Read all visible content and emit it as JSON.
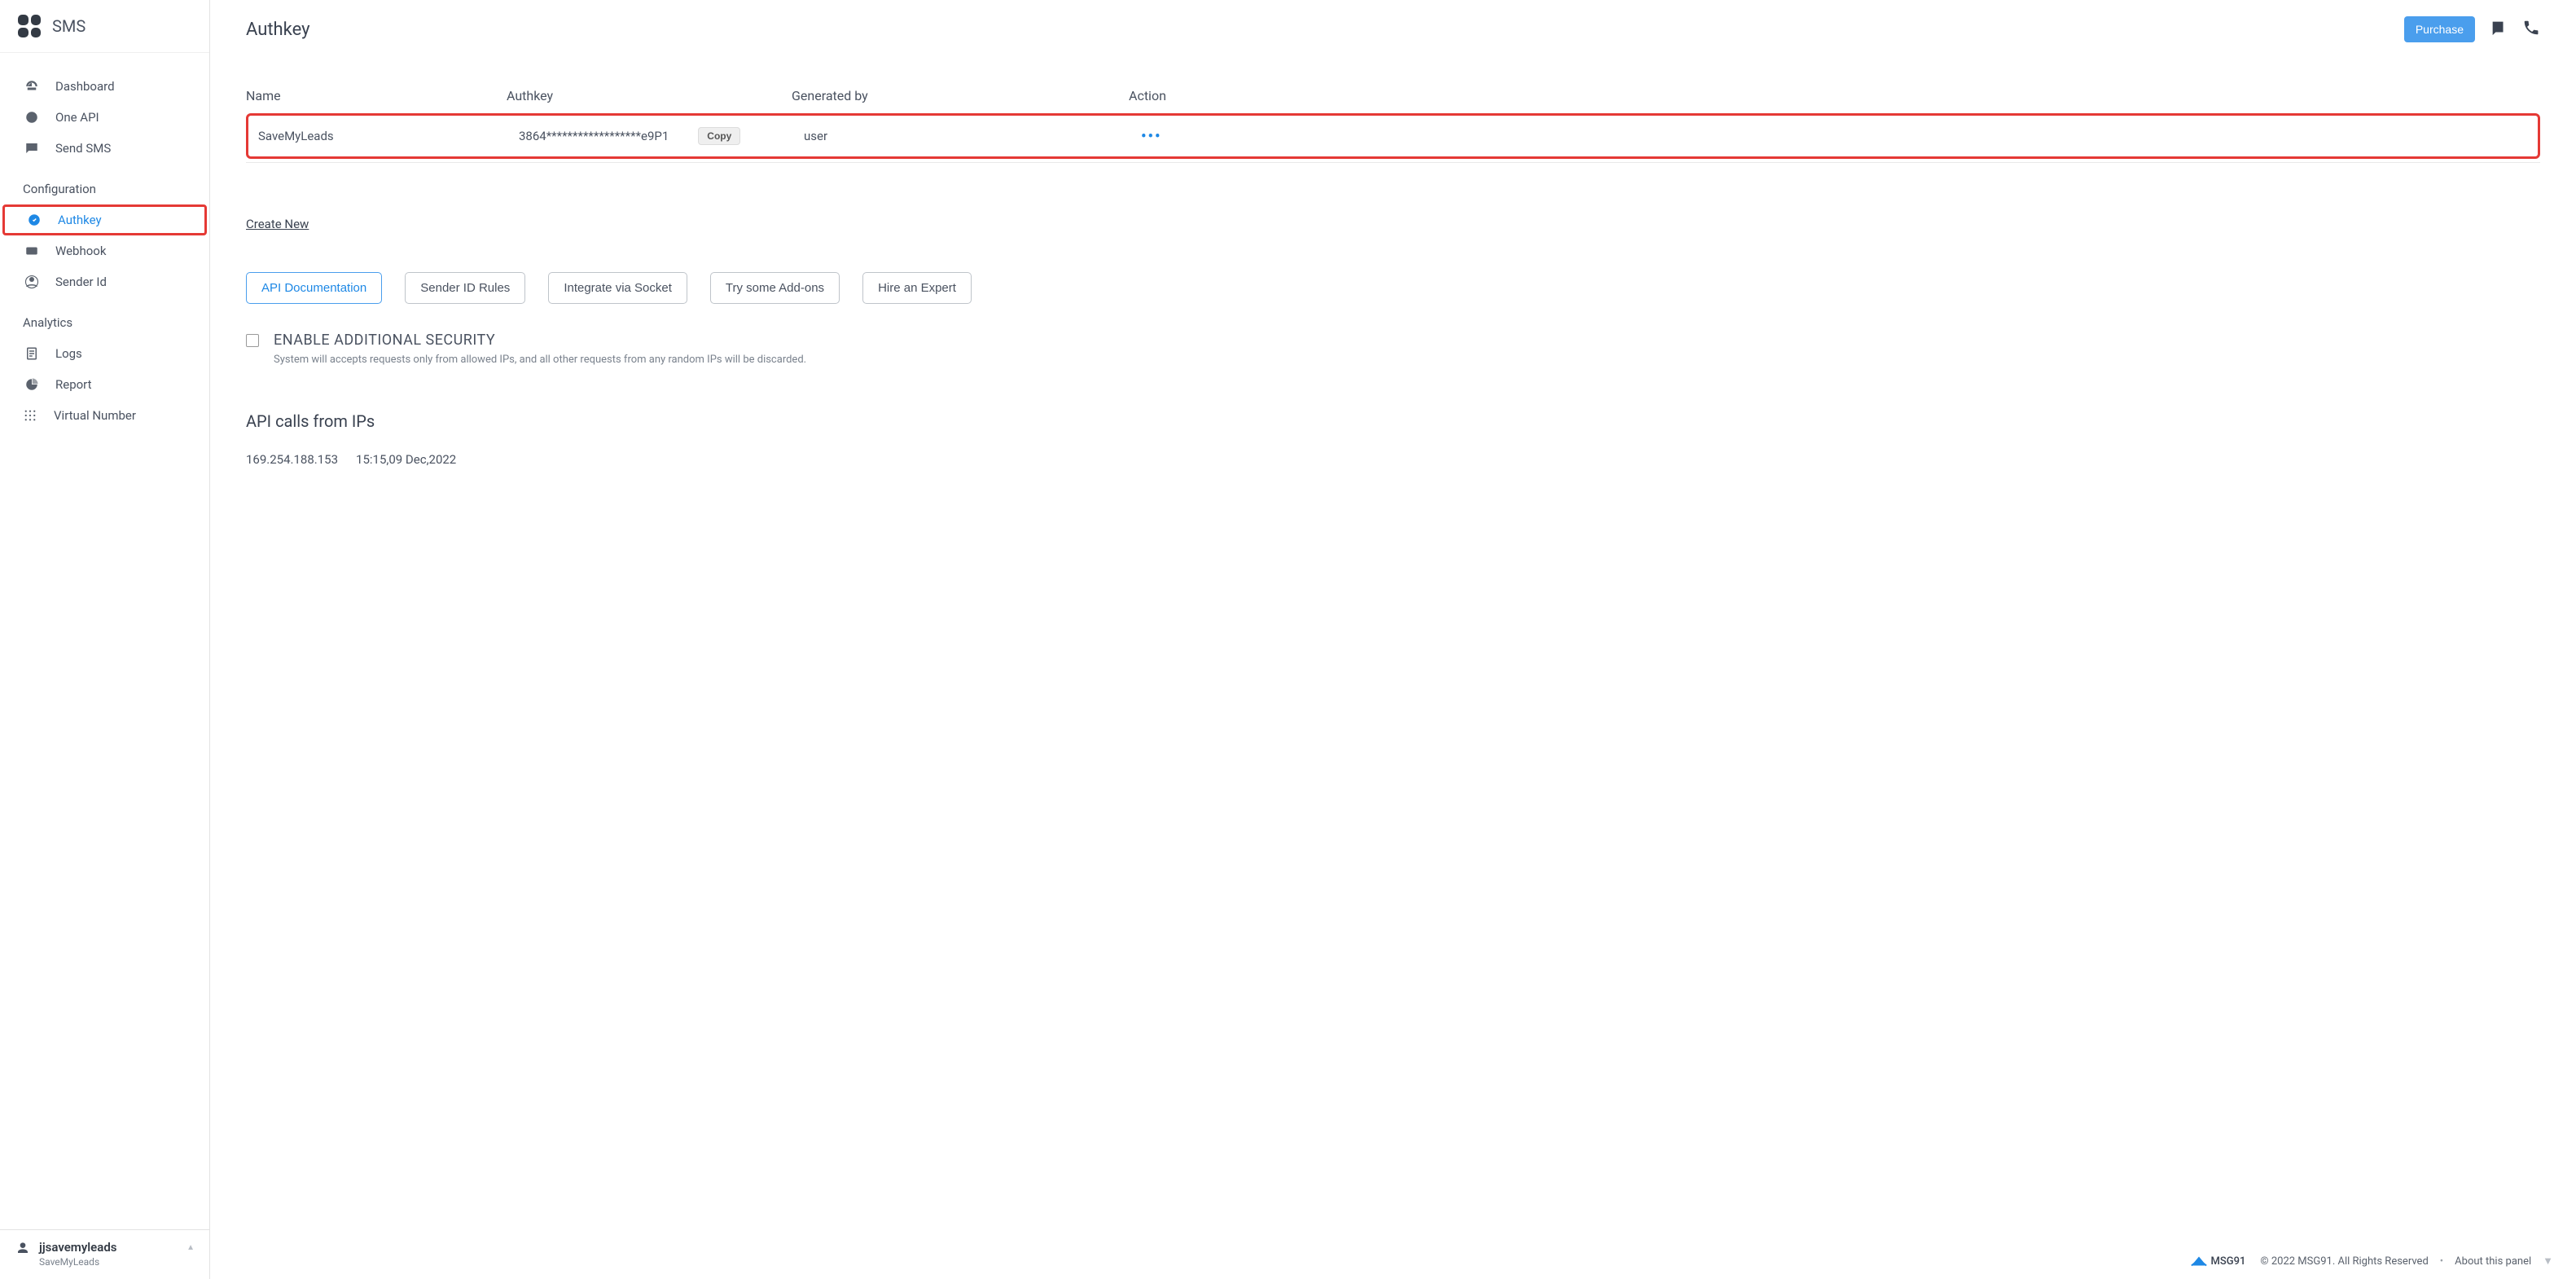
{
  "sidebar": {
    "title": "SMS",
    "nav_primary": [
      {
        "label": "Dashboard",
        "icon": "dashboard-icon"
      },
      {
        "label": "One API",
        "icon": "oneapi-icon"
      },
      {
        "label": "Send SMS",
        "icon": "sendsms-icon"
      }
    ],
    "config_title": "Configuration",
    "nav_config": [
      {
        "label": "Authkey",
        "icon": "authkey-icon",
        "active": true,
        "highlighted": true
      },
      {
        "label": "Webhook",
        "icon": "webhook-icon"
      },
      {
        "label": "Sender Id",
        "icon": "senderid-icon"
      }
    ],
    "analytics_title": "Analytics",
    "nav_analytics": [
      {
        "label": "Logs",
        "icon": "logs-icon"
      },
      {
        "label": "Report",
        "icon": "report-icon"
      }
    ],
    "virtual_number": "Virtual Number",
    "user": {
      "name": "jjsavemyleads",
      "company": "SaveMyLeads"
    }
  },
  "header": {
    "title": "Authkey",
    "purchase": "Purchase"
  },
  "table": {
    "columns": {
      "name": "Name",
      "authkey": "Authkey",
      "generated_by": "Generated by",
      "action": "Action"
    },
    "row": {
      "name": "SaveMyLeads",
      "authkey": "3864******************e9P1",
      "copy": "Copy",
      "generated_by": "user"
    }
  },
  "links": {
    "create_new": "Create New"
  },
  "buttons": {
    "api_docs": "API Documentation",
    "sender_rules": "Sender ID Rules",
    "integrate": "Integrate via Socket",
    "addons": "Try some Add-ons",
    "hire": "Hire an Expert"
  },
  "security": {
    "label": "ENABLE ADDITIONAL SECURITY",
    "desc": "System will accepts requests only from allowed IPs, and all other requests from any random IPs will be discarded."
  },
  "ips": {
    "title": "API calls from IPs",
    "ip": "169.254.188.153",
    "timestamp": "15:15,09 Dec,2022"
  },
  "footer": {
    "brand": "MSG91",
    "copyright": "© 2022 MSG91. All Rights Reserved",
    "about": "About this panel"
  }
}
